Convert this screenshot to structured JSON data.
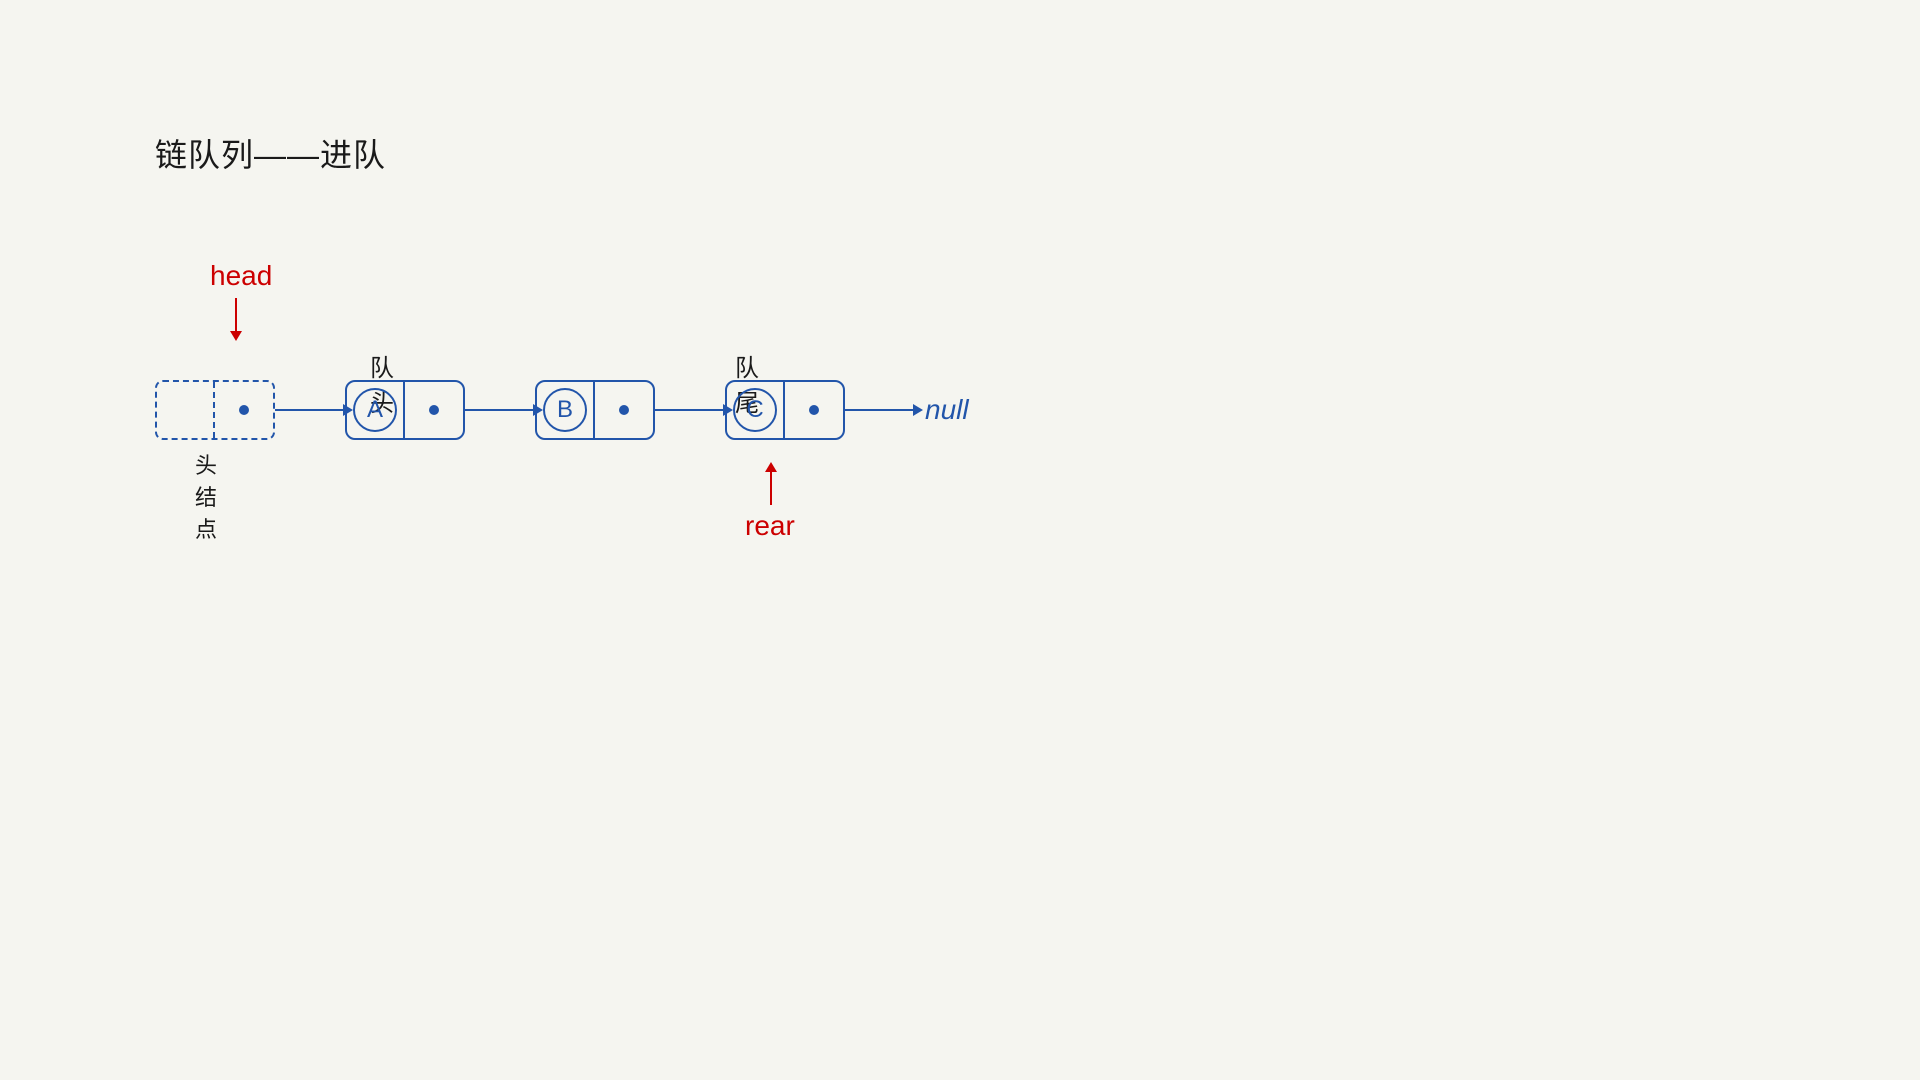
{
  "page": {
    "title": "链队列——进队",
    "diagram": {
      "head_label": "head",
      "queue_head_label": "队头",
      "queue_tail_label": "队尾",
      "head_node_label": "头结点",
      "rear_label": "rear",
      "null_label": "null",
      "nodes": [
        {
          "id": "head-node",
          "type": "head",
          "data": "",
          "pointer": "dot"
        },
        {
          "id": "node-a",
          "type": "regular",
          "data": "A",
          "pointer": "dot"
        },
        {
          "id": "node-b",
          "type": "regular",
          "data": "B",
          "pointer": "dot"
        },
        {
          "id": "node-c",
          "type": "regular",
          "data": "C",
          "pointer": "dot"
        }
      ]
    }
  }
}
